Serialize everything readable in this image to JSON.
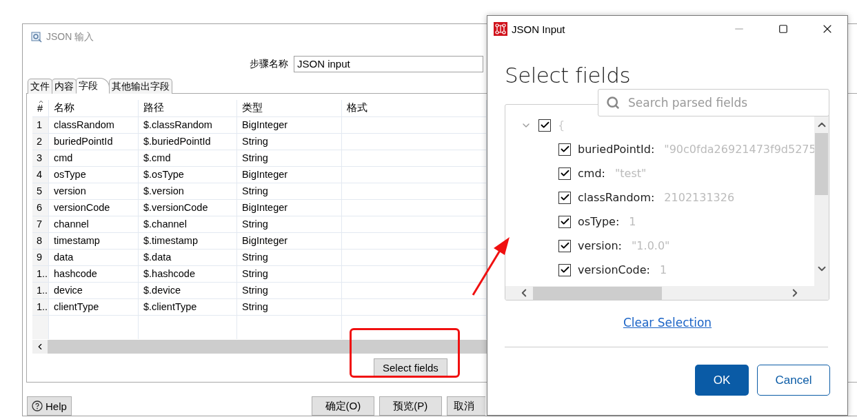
{
  "background_dialog": {
    "title": "JSON 输入",
    "step_name": {
      "label": "步骤名称",
      "value": "JSON input"
    },
    "tabs": [
      {
        "label": "文件",
        "selected": false
      },
      {
        "label": "内容",
        "selected": false
      },
      {
        "label": "字段",
        "selected": true
      },
      {
        "label": "其他输出字段",
        "selected": false
      }
    ],
    "table": {
      "columns": [
        "#",
        "名称",
        "路径",
        "类型",
        "格式"
      ],
      "rows": [
        [
          "1",
          "classRandom",
          "$.classRandom",
          "BigInteger"
        ],
        [
          "2",
          "buriedPointId",
          "$.buriedPointId",
          "String"
        ],
        [
          "3",
          "cmd",
          "$.cmd",
          "String"
        ],
        [
          "4",
          "osType",
          "$.osType",
          "BigInteger"
        ],
        [
          "5",
          "version",
          "$.version",
          "String"
        ],
        [
          "6",
          "versionCode",
          "$.versionCode",
          "BigInteger"
        ],
        [
          "7",
          "channel",
          "$.channel",
          "String"
        ],
        [
          "8",
          "timestamp",
          "$.timestamp",
          "BigInteger"
        ],
        [
          "9",
          "data",
          "$.data",
          "String"
        ],
        [
          "1..",
          "hashcode",
          "$.hashcode",
          "String"
        ],
        [
          "1..",
          "device",
          "$.device",
          "String"
        ],
        [
          "1..",
          "clientType",
          "$.clientType",
          "String"
        ]
      ]
    },
    "select_fields_button": "Select fields",
    "help_button": "Help",
    "buttons": [
      "确定(O)",
      "预览(P)",
      "取消"
    ]
  },
  "select_dialog": {
    "title": "JSON Input",
    "heading": "Select fields",
    "search": {
      "placeholder": "Search parsed fields"
    },
    "tree": {
      "label": "{",
      "checked": true,
      "expanded": true,
      "children": [
        {
          "key": "buriedPointId:",
          "value": "\"90c0fda26921473f9d5275",
          "checked": true
        },
        {
          "key": "cmd:",
          "value": "\"test\"",
          "checked": true
        },
        {
          "key": "classRandom:",
          "value": "2102131326",
          "checked": true
        },
        {
          "key": "osType:",
          "value": "1",
          "checked": true
        },
        {
          "key": "version:",
          "value": "\"1.0.0\"",
          "checked": true
        },
        {
          "key": "versionCode:",
          "value": "1",
          "checked": true
        }
      ]
    },
    "clear_link": "Clear Selection",
    "ok_button": "OK",
    "cancel_button": "Cancel"
  }
}
